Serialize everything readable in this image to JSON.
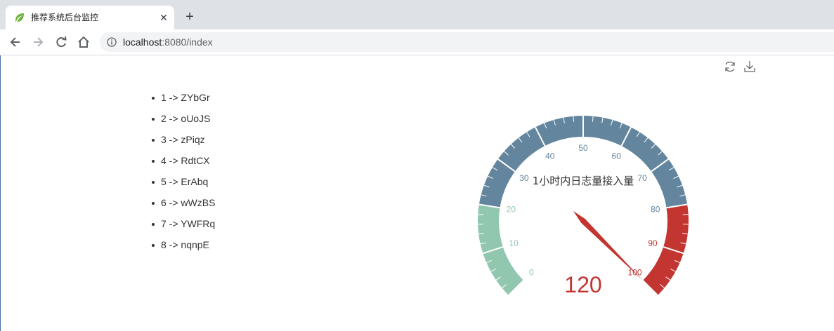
{
  "browser": {
    "tab_title": "推荐系统后台监控",
    "close_glyph": "✕",
    "newtab_glyph": "+",
    "url_host": "localhost",
    "url_rest": ":8080/index"
  },
  "list": [
    {
      "label": "1 -> ZYbGr"
    },
    {
      "label": "2 -> oUoJS"
    },
    {
      "label": "3 -> zPiqz"
    },
    {
      "label": "4 -> RdtCX"
    },
    {
      "label": "5 -> ErAbq"
    },
    {
      "label": "6 -> wWzBS"
    },
    {
      "label": "7 -> YWFRq"
    },
    {
      "label": "8 -> nqnpE"
    }
  ],
  "toolbox": {
    "refresh_icon": "refresh-icon",
    "download_icon": "download-icon"
  },
  "chart_data": {
    "type": "gauge",
    "title": "1小时内日志量接入量",
    "min": 0,
    "max": 100,
    "value": 120,
    "value_label": "120",
    "tick_labels": [
      "0",
      "10",
      "20",
      "30",
      "40",
      "50",
      "60",
      "70",
      "80",
      "90",
      "100"
    ],
    "bands": [
      {
        "to": 0.2,
        "color": "#91c7ae"
      },
      {
        "to": 0.8,
        "color": "#63869e"
      },
      {
        "to": 1.0,
        "color": "#c23531"
      }
    ],
    "pointer_color": "#c23531"
  }
}
